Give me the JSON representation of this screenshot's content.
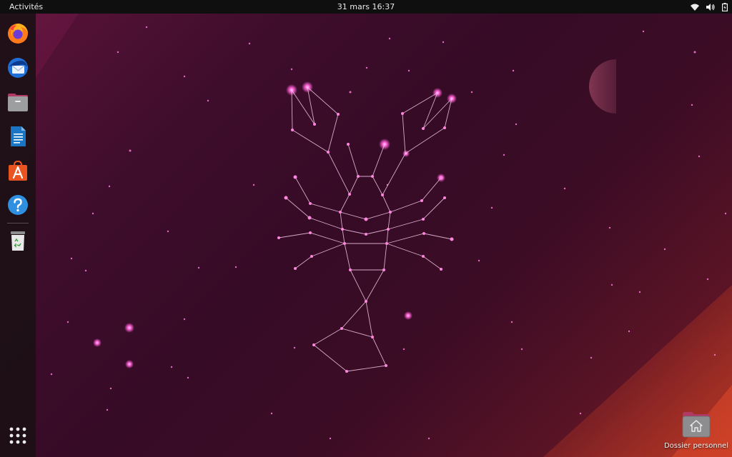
{
  "topbar": {
    "activities_label": "Activités",
    "clock": "31 mars  16:37",
    "status_icons": [
      "wifi-icon",
      "volume-icon",
      "battery-icon"
    ]
  },
  "dock": {
    "apps": [
      {
        "name": "Firefox",
        "icon": "firefox-icon"
      },
      {
        "name": "Thunderbird",
        "icon": "thunderbird-icon"
      },
      {
        "name": "Fichiers",
        "icon": "files-icon"
      },
      {
        "name": "LibreOffice Writer",
        "icon": "writer-icon"
      },
      {
        "name": "Ubuntu Software",
        "icon": "software-store-icon"
      },
      {
        "name": "Aide",
        "icon": "help-icon"
      },
      {
        "name": "Corbeille",
        "icon": "trash-icon"
      }
    ],
    "show_apps_icon": "app-grid-icon"
  },
  "desktop": {
    "home_folder_label": "Dossier personnel",
    "wallpaper": "lunar-lobster-constellation"
  },
  "colors": {
    "topbar_bg": "#0f0f10",
    "accent_orange": "#e95420",
    "constellation_pink": "#ff5fd6"
  }
}
